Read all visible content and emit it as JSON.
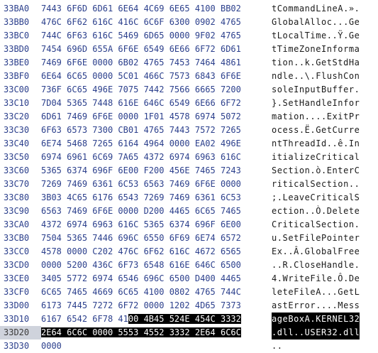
{
  "editor": {
    "rows": [
      {
        "addr": "33BA0",
        "hex": [
          "7443",
          "6F6D",
          "6D61",
          "6E64",
          "4C69",
          "6E65",
          "4100",
          "BB02"
        ],
        "ascii": "tCommandLineA.»."
      },
      {
        "addr": "33BB0",
        "hex": [
          "476C",
          "6F62",
          "616C",
          "416C",
          "6C6F",
          "6300",
          "0902",
          "4765"
        ],
        "ascii": "GlobalAlloc...Ge"
      },
      {
        "addr": "33BC0",
        "hex": [
          "744C",
          "6F63",
          "616C",
          "5469",
          "6D65",
          "0000",
          "9F02",
          "4765"
        ],
        "ascii": "tLocalTime..Ÿ.Ge"
      },
      {
        "addr": "33BD0",
        "hex": [
          "7454",
          "696D",
          "655A",
          "6F6E",
          "6549",
          "6E66",
          "6F72",
          "6D61"
        ],
        "ascii": "tTimeZoneInforma"
      },
      {
        "addr": "33BE0",
        "hex": [
          "7469",
          "6F6E",
          "0000",
          "6B02",
          "4765",
          "7453",
          "7464",
          "4861"
        ],
        "ascii": "tion..k.GetStdHa"
      },
      {
        "addr": "33BF0",
        "hex": [
          "6E64",
          "6C65",
          "0000",
          "5C01",
          "466C",
          "7573",
          "6843",
          "6F6E"
        ],
        "ascii": "ndle..\\.FlushCon"
      },
      {
        "addr": "33C00",
        "hex": [
          "736F",
          "6C65",
          "496E",
          "7075",
          "7442",
          "7566",
          "6665",
          "7200"
        ],
        "ascii": "soleInputBuffer."
      },
      {
        "addr": "33C10",
        "hex": [
          "7D04",
          "5365",
          "7448",
          "616E",
          "646C",
          "6549",
          "6E66",
          "6F72"
        ],
        "ascii": "}.SetHandleInfor"
      },
      {
        "addr": "33C20",
        "hex": [
          "6D61",
          "7469",
          "6F6E",
          "0000",
          "1F01",
          "4578",
          "6974",
          "5072"
        ],
        "ascii": "mation....ExitPr"
      },
      {
        "addr": "33C30",
        "hex": [
          "6F63",
          "6573",
          "7300",
          "CB01",
          "4765",
          "7443",
          "7572",
          "7265"
        ],
        "ascii": "ocess.Ë.GetCurre"
      },
      {
        "addr": "33C40",
        "hex": [
          "6E74",
          "5468",
          "7265",
          "6164",
          "4964",
          "0000",
          "EA02",
          "496E"
        ],
        "ascii": "ntThreadId..ê.In"
      },
      {
        "addr": "33C50",
        "hex": [
          "6974",
          "6961",
          "6C69",
          "7A65",
          "4372",
          "6974",
          "6963",
          "616C"
        ],
        "ascii": "itializeCritical"
      },
      {
        "addr": "33C60",
        "hex": [
          "5365",
          "6374",
          "696F",
          "6E00",
          "F200",
          "456E",
          "7465",
          "7243"
        ],
        "ascii": "Section.ò.EnterC"
      },
      {
        "addr": "33C70",
        "hex": [
          "7269",
          "7469",
          "6361",
          "6C53",
          "6563",
          "7469",
          "6F6E",
          "0000"
        ],
        "ascii": "riticalSection.."
      },
      {
        "addr": "33C80",
        "hex": [
          "3B03",
          "4C65",
          "6176",
          "6543",
          "7269",
          "7469",
          "6361",
          "6C53"
        ],
        "ascii": ";.LeaveCriticalS"
      },
      {
        "addr": "33C90",
        "hex": [
          "6563",
          "7469",
          "6F6E",
          "0000",
          "D200",
          "4465",
          "6C65",
          "7465"
        ],
        "ascii": "ection..Ò.Delete"
      },
      {
        "addr": "33CA0",
        "hex": [
          "4372",
          "6974",
          "6963",
          "616C",
          "5365",
          "6374",
          "696F",
          "6E00"
        ],
        "ascii": "CriticalSection."
      },
      {
        "addr": "33CB0",
        "hex": [
          "7504",
          "5365",
          "7446",
          "696C",
          "6550",
          "6F69",
          "6E74",
          "6572"
        ],
        "ascii": "u.SetFilePointer"
      },
      {
        "addr": "33CC0",
        "hex": [
          "4578",
          "0000",
          "C202",
          "476C",
          "6F62",
          "616C",
          "4672",
          "6565"
        ],
        "ascii": "Ex..Â.GlobalFree"
      },
      {
        "addr": "33CD0",
        "hex": [
          "0000",
          "5200",
          "436C",
          "6F73",
          "6548",
          "616E",
          "646C",
          "6500"
        ],
        "ascii": "..R.CloseHandle."
      },
      {
        "addr": "33CE0",
        "hex": [
          "3405",
          "5772",
          "6974",
          "6546",
          "696C",
          "6500",
          "D400",
          "4465"
        ],
        "ascii": "4.WriteFile.Ô.De"
      },
      {
        "addr": "33CF0",
        "hex": [
          "6C65",
          "7465",
          "4669",
          "6C65",
          "4100",
          "0802",
          "4765",
          "744C"
        ],
        "ascii": "leteFileA...GetL"
      },
      {
        "addr": "33D00",
        "hex": [
          "6173",
          "7445",
          "7272",
          "6F72",
          "0000",
          "1202",
          "4D65",
          "7373"
        ],
        "ascii": "astError....Mess"
      },
      {
        "addr": "33D10",
        "hex": [
          "6167",
          "6542",
          "6F78",
          "4100",
          "4B45",
          "524E",
          "454C",
          "3332"
        ],
        "ascii": "ageBoxA.KERNEL32"
      },
      {
        "addr": "33D20",
        "hex": [
          "2E64",
          "6C6C",
          "0000",
          "5553",
          "4552",
          "3332",
          "2E64",
          "6C6C"
        ],
        "ascii": ".dll..USER32.dll"
      },
      {
        "addr": "33D30",
        "hex": [
          "0000"
        ],
        "ascii": ".."
      }
    ]
  }
}
